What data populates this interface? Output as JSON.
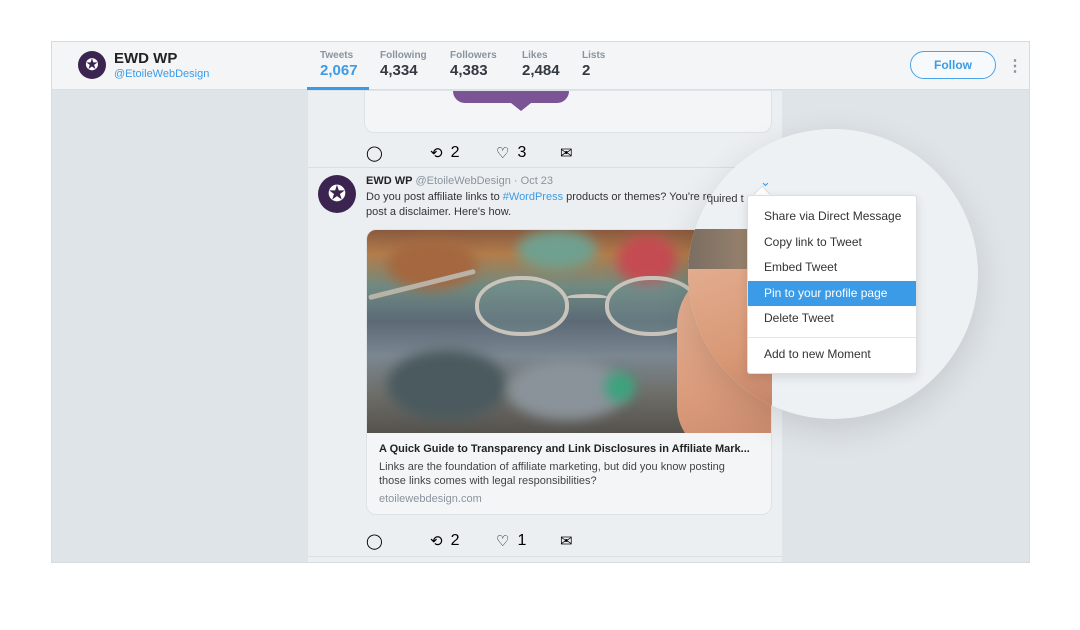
{
  "profile": {
    "name": "EWD WP",
    "handle": "@EtoileWebDesign"
  },
  "stats": [
    {
      "label": "Tweets",
      "value": "2,067",
      "active": true
    },
    {
      "label": "Following",
      "value": "4,334"
    },
    {
      "label": "Followers",
      "value": "4,383"
    },
    {
      "label": "Likes",
      "value": "2,484"
    },
    {
      "label": "Lists",
      "value": "2"
    }
  ],
  "follow_label": "Follow",
  "previous_tweet": {
    "retweets": "2",
    "likes": "3"
  },
  "tweet": {
    "author": "EWD WP",
    "handle": "@EtoileWebDesign",
    "date": "· Oct 23",
    "text_before": "Do you post affiliate links to ",
    "hashtag": "#WordPress",
    "text_after": " products or themes? You're required to post a disclaimer. Here's how.",
    "card": {
      "title": "A Quick Guide to Transparency and Link Disclosures in Affiliate Mark...",
      "description": "Links are the foundation of affiliate marketing, but did you know posting those links comes with legal responsibilities?",
      "domain": "etoilewebdesign.com"
    },
    "retweets": "2",
    "likes": "1"
  },
  "magnifier": {
    "text_fragment": "...required t"
  },
  "menu": {
    "items": [
      "Share via Direct Message",
      "Copy link to Tweet",
      "Embed Tweet",
      "Pin to your profile page",
      "Delete Tweet"
    ],
    "highlighted_index": 3,
    "extra_item": "Add to new Moment"
  },
  "colors": {
    "accent": "#3b9be6",
    "avatar": "#3c2450"
  }
}
